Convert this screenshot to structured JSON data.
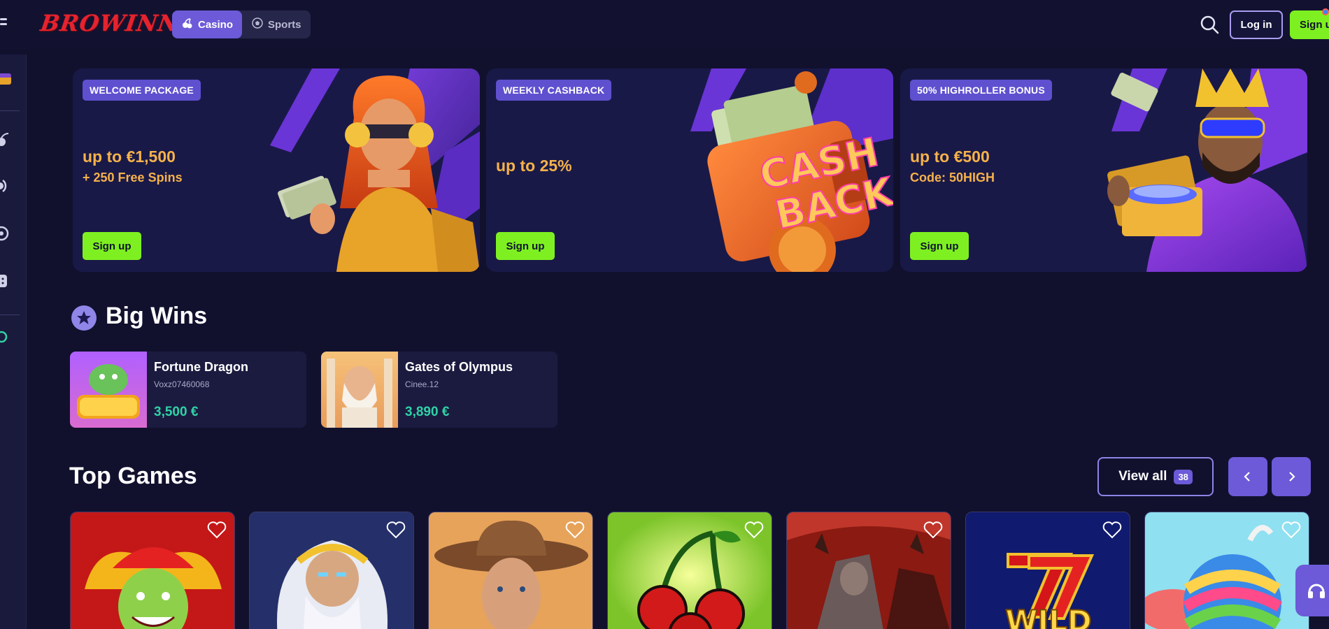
{
  "header": {
    "logo": "BROWINNER",
    "modes": [
      {
        "label": "Casino",
        "icon": "cherries-icon",
        "active": true
      },
      {
        "label": "Sports",
        "icon": "soccer-ball-icon",
        "active": false
      }
    ],
    "search_icon": "search-icon",
    "login_label": "Log in",
    "signup_label": "Sign up"
  },
  "sidebar": {
    "icons": [
      "treasure-icon",
      "cherries-icon",
      "live-icon",
      "roulette-icon",
      "dice-icon",
      "support-icon"
    ]
  },
  "banners": [
    {
      "tag": "WELCOME PACKAGE",
      "amount": "up to €1,500",
      "sub": "+ 250 Free Spins",
      "button": "Sign up"
    },
    {
      "tag": "WEEKLY CASHBACK",
      "amount": "up to 25%",
      "sub": "",
      "art_text_1": "CASH",
      "art_text_2": "BACK",
      "button": "Sign up"
    },
    {
      "tag": "50% HIGHROLLER BONUS",
      "amount": "up to €500",
      "sub": "Code: 50HIGH",
      "button": "Sign up"
    }
  ],
  "big_wins": {
    "title": "Big Wins",
    "items": [
      {
        "game": "Fortune Dragon",
        "user": "Voxz07460068",
        "amount": "3,500 €"
      },
      {
        "game": "Gates of Olympus",
        "user": "Cinee.12",
        "amount": "3,890 €"
      }
    ]
  },
  "top_games": {
    "title": "Top Games",
    "view_all_label": "View all",
    "count": "38",
    "games": [
      {
        "name": "joker-game"
      },
      {
        "name": "zeus-game"
      },
      {
        "name": "cowboy-game"
      },
      {
        "name": "cherry-game"
      },
      {
        "name": "warrior-game"
      },
      {
        "name": "wild-sevens-game",
        "art_text": "WILD"
      },
      {
        "name": "candy-game"
      }
    ]
  },
  "colors": {
    "background": "#11112e",
    "accent": "#6c5ad8",
    "cta_green": "#7ef021",
    "amount_orange": "#f6b24a",
    "win_green": "#2fd3a6"
  }
}
